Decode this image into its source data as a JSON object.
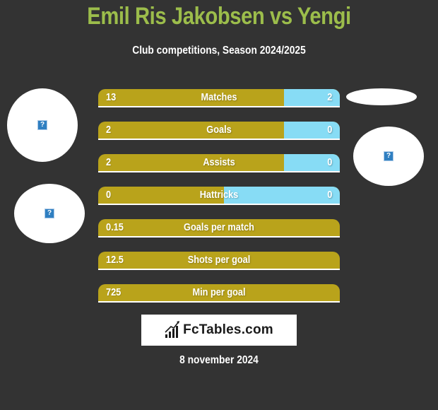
{
  "header": {
    "title": "Emil Ris Jakobsen vs Yengi",
    "subtitle": "Club competitions, Season 2024/2025"
  },
  "colors": {
    "background": "#333333",
    "title": "#9cbd4b",
    "left_bar": "#b9a31b",
    "right_bar": "#87dcf5"
  },
  "players": {
    "left": {
      "name": "Emil Ris Jakobsen",
      "avatar_icon": "broken-image-icon"
    },
    "right": {
      "name": "Yengi",
      "avatar_icon": "broken-image-icon"
    }
  },
  "stats": [
    {
      "label": "Matches",
      "left": "13",
      "right": "2",
      "right_share": 0.23
    },
    {
      "label": "Goals",
      "left": "2",
      "right": "0",
      "right_share": 0.23
    },
    {
      "label": "Assists",
      "left": "2",
      "right": "0",
      "right_share": 0.23
    },
    {
      "label": "Hattricks",
      "left": "0",
      "right": "0",
      "right_share": 0.48
    },
    {
      "label": "Goals per match",
      "left": "0.15",
      "right": null,
      "right_share": 0
    },
    {
      "label": "Shots per goal",
      "left": "12.5",
      "right": null,
      "right_share": 0
    },
    {
      "label": "Min per goal",
      "left": "725",
      "right": null,
      "right_share": 0
    }
  ],
  "footer": {
    "logo_text": "FcTables.com",
    "logo_icon": "bar-chart-trend-icon",
    "date": "8 november 2024"
  }
}
